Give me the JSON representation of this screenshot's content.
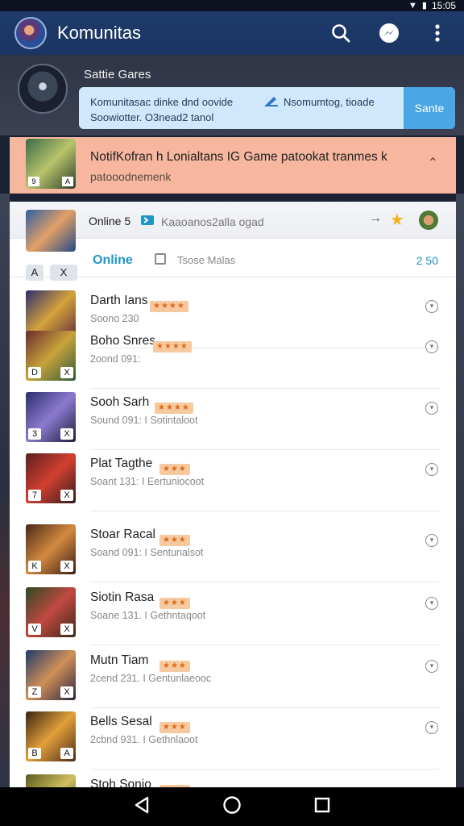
{
  "status_bar": {
    "time": "15:05"
  },
  "app_bar": {
    "title": "Komunitas"
  },
  "header": {
    "group_name": "Sattie Gares",
    "promo_line1_left": "Komunitasac dinke dnd oovide",
    "promo_line1_right": "Nsomumtog, tioade",
    "promo_line2": "Soowiotter. O3nead2 tanol",
    "promo_button": "Sante"
  },
  "notification": {
    "title": "NotifKofran h Lonialtans IG Game patookat tranmes k",
    "subtitle": "patooodnemenk"
  },
  "list_header": {
    "online_label": "Online 5",
    "search_text": "Kaaoanos2alla ogad"
  },
  "filter": {
    "online_label": "Online",
    "checkbox_label": "Tsose Malas",
    "count": "2 50",
    "toggle_1": "A",
    "toggle_2": "X"
  },
  "items": [
    {
      "name": "Darth Ians",
      "meta": "Soono 230",
      "stars": "★★★★",
      "badge_l": "",
      "badge_r": "",
      "colors": [
        "#2a2f6e",
        "#d5a23a",
        "#5a2a40"
      ]
    },
    {
      "name": "Boho Snres",
      "meta": "2oond 091:",
      "stars": "★★★★",
      "badge_l": "D",
      "badge_r": "X",
      "colors": [
        "#6a2a2e",
        "#c9a33b",
        "#2d5a3a"
      ]
    },
    {
      "name": "Sooh Sarh",
      "meta": "Sound 091: I Sotintaloot",
      "stars": "★★★★",
      "badge_l": "3",
      "badge_r": "X",
      "colors": [
        "#2c2e6a",
        "#8c7ad0",
        "#1c1f3a"
      ]
    },
    {
      "name": "Plat Tagthe",
      "meta": "Soant 131: I Eertuniocoot",
      "stars": "★★★",
      "badge_l": "7",
      "badge_r": "X",
      "colors": [
        "#5a1f20",
        "#d24030",
        "#301c1e"
      ]
    },
    {
      "name": "Stoar Racal",
      "meta": "Soand 091: I Sentunalsot",
      "stars": "★★★",
      "badge_l": "K",
      "badge_r": "X",
      "colors": [
        "#4a2818",
        "#d38a40",
        "#3a1c14"
      ]
    },
    {
      "name": "Siotin Rasa",
      "meta": "Soane 131. I Gethntaqoot",
      "stars": "★★★",
      "badge_l": "V",
      "badge_r": "X",
      "colors": [
        "#2d4a25",
        "#c24840",
        "#3a2a1a"
      ]
    },
    {
      "name": "Mutn Tiam",
      "meta": "2cend 231. I Gentunlaeooc",
      "stars": "★★★",
      "badge_l": "Z",
      "badge_r": "X",
      "colors": [
        "#1f3a6a",
        "#d09058",
        "#2a2440"
      ]
    },
    {
      "name": "Bells Sesal",
      "meta": "2cbnd 931. I Gethnlaoot",
      "stars": "★★★",
      "badge_l": "B",
      "badge_r": "A",
      "colors": [
        "#3a2410",
        "#e2a03a",
        "#4a2a1a"
      ]
    },
    {
      "name": "Stoh Sonio",
      "meta": "",
      "stars": "★★★",
      "badge_l": "",
      "badge_r": "",
      "colors": [
        "#5a5a20",
        "#d0c060",
        "#3a3a18"
      ]
    }
  ],
  "nav": {
    "back": "back-icon",
    "home": "home-icon",
    "recents": "recents-icon"
  }
}
